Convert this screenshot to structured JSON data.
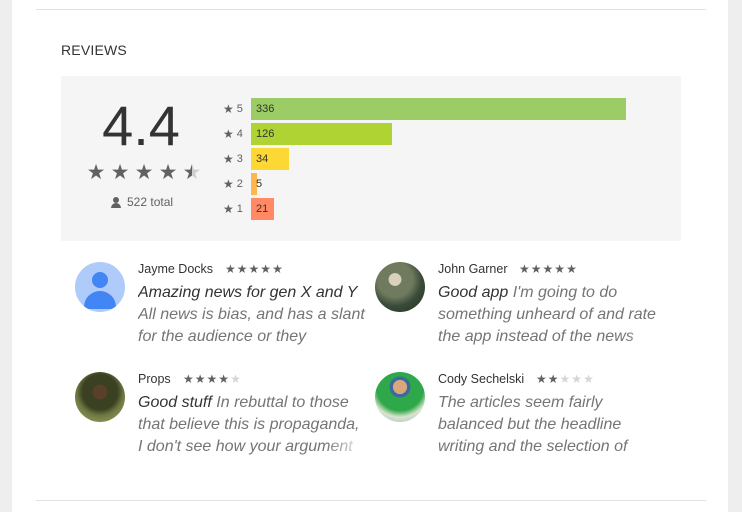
{
  "section": {
    "title": "REVIEWS"
  },
  "summary": {
    "score": "4.4",
    "stars_filled": 4,
    "stars_half": true,
    "total": "522 total",
    "star_glyph": "★",
    "person_icon": "person-icon"
  },
  "histogram": [
    {
      "star": "5",
      "count": "336",
      "value": 336,
      "color": "#9ccc65"
    },
    {
      "star": "4",
      "count": "126",
      "value": 126,
      "color": "#aed332"
    },
    {
      "star": "3",
      "count": "34",
      "value": 34,
      "color": "#fdd835"
    },
    {
      "star": "2",
      "count": "5",
      "value": 5,
      "color": "#ffb74d"
    },
    {
      "star": "1",
      "count": "21",
      "value": 21,
      "color": "#ff8a65"
    }
  ],
  "reviews": [
    {
      "name": "Jayme Docks",
      "rating": 5,
      "title": "Amazing news for gen X and Y",
      "body": "All news is bias, and has a slant for the audience or they",
      "avatar": "default-user-avatar"
    },
    {
      "name": "John Garner",
      "rating": 5,
      "title": "Good app",
      "body": "I'm going to do something unheard of and rate the app instead of the news",
      "avatar": "photo-avatar"
    },
    {
      "name": "Props",
      "rating": 4,
      "title": "Good stuff",
      "body": "In rebuttal to those that believe this is propaganda, I don't see how your argument",
      "avatar": "photo-avatar"
    },
    {
      "name": "Cody Sechelski",
      "rating": 2,
      "title": "",
      "body": "The articles seem fairly balanced but the headline writing and the selection of",
      "avatar": "photo-avatar"
    }
  ]
}
